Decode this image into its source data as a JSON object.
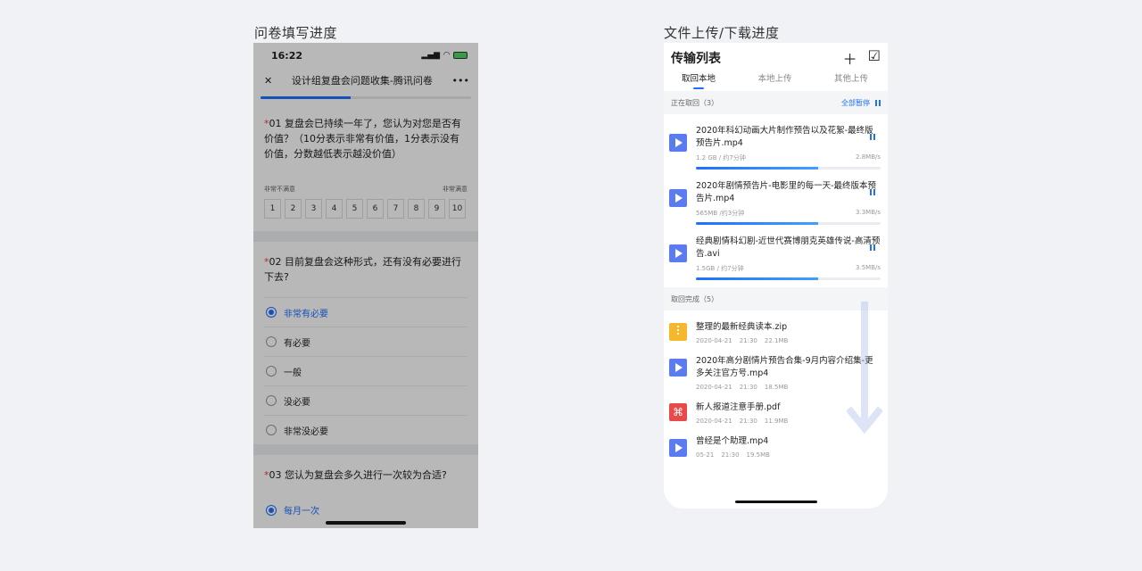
{
  "captions": {
    "left": "问卷填写进度",
    "right": "文件上传/下载进度"
  },
  "survey": {
    "status_time": "16:22",
    "nav_title": "设计组复盘会问题收集-腾讯问卷",
    "close_icon": "close-icon",
    "more_icon": "more-icon",
    "progress": 0.43,
    "q1": {
      "star": "*",
      "text": "01 复盘会已持续一年了，您认为对您是否有价值？（10分表示非常有价值，1分表示没有价值，分数越低表示越没价值）",
      "low_label": "非常不满意",
      "high_label": "非常满意",
      "scale": [
        "1",
        "2",
        "3",
        "4",
        "5",
        "6",
        "7",
        "8",
        "9",
        "10"
      ]
    },
    "q2": {
      "star": "*",
      "text": "02 目前复盘会这种形式，还有没有必要进行下去?",
      "options": [
        "非常有必要",
        "有必要",
        "一般",
        "没必要",
        "非常没必要"
      ],
      "selected": "非常有必要"
    },
    "q3": {
      "star": "*",
      "text": "03 您认为复盘会多久进行一次较为合适?",
      "first_option": "每月一次"
    }
  },
  "transfer": {
    "title": "传输列表",
    "tabs": [
      "取回本地",
      "本地上传",
      "其他上传"
    ],
    "active_tab": "取回本地",
    "active_header": "正在取回（3）",
    "pause_all": "全部暂停",
    "active_items": [
      {
        "name": "2020年科幻动画大片制作预告以及花絮-最终版预告片.mp4",
        "size": "1.2 GB / 约7分钟",
        "speed": "2.8MB/s",
        "progress": 0.66
      },
      {
        "name": "2020年剧情预告片-电影里的每一天-最终版本预告片.mp4",
        "size": "565MB /约3分钟",
        "speed": "3.3MB/s",
        "progress": 0.66
      },
      {
        "name": "经典剧情科幻剧-近世代赛博朋克英雄传说-高清预告.avi",
        "size": "1.5GB / 约7分钟",
        "speed": "3.5MB/s",
        "progress": 0.66
      }
    ],
    "done_header": "取回完成（5）",
    "done_items": [
      {
        "icon": "zip-file-icon",
        "name": "整理的最新经典读本.zip",
        "date": "2020-04-21",
        "time": "21:30",
        "size": "22.1MB"
      },
      {
        "icon": "video-file-icon",
        "name": "2020年高分剧情片预告合集-9月内容介绍集-更多关注官方号.mp4",
        "date": "2020-04-21",
        "time": "21:30",
        "size": "18.5MB"
      },
      {
        "icon": "pdf-file-icon",
        "name": "新人报道注意手册.pdf",
        "date": "2020-04-21",
        "time": "21:30",
        "size": "11.9MB"
      },
      {
        "icon": "video-file-icon",
        "name": "曾经是个助理.mp4",
        "date": "05-21",
        "time": "21:30",
        "size": "19.5MB"
      }
    ]
  }
}
